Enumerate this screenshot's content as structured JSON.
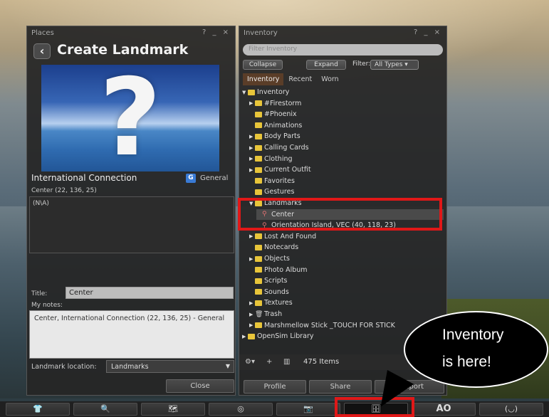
{
  "places": {
    "title": "Places",
    "controls": "? _ ×",
    "back_icon": "‹",
    "heading": "Create Landmark",
    "parcel_name": "International Connection",
    "rating_badge": "G",
    "rating_label": "General",
    "location": "Center (22, 136, 25)",
    "description": "(N\\A)",
    "title_label": "Title:",
    "title_value": "Center",
    "notes_label": "My notes:",
    "notes_value": "Center, International Connection (22, 136, 25) - General",
    "landmark_location_label": "Landmark location:",
    "landmark_location_value": "Landmarks",
    "close_label": "Close"
  },
  "inventory": {
    "title": "Inventory",
    "controls": "? _ ×",
    "filter_placeholder": "Filter Inventory",
    "collapse_label": "Collapse",
    "expand_label": "Expand",
    "filter_label": "Filter:",
    "filter_value": "All Types",
    "tabs": [
      "Inventory",
      "Recent",
      "Worn"
    ],
    "tree": [
      {
        "label": "Inventory",
        "depth": 0,
        "expanded": true,
        "kind": "folder"
      },
      {
        "label": "#Firestorm",
        "depth": 1,
        "expanded": false,
        "kind": "folder"
      },
      {
        "label": "#Phoenix",
        "depth": 1,
        "kind": "folder"
      },
      {
        "label": "Animations",
        "depth": 1,
        "kind": "folder"
      },
      {
        "label": "Body Parts",
        "depth": 1,
        "expanded": false,
        "kind": "folder"
      },
      {
        "label": "Calling Cards",
        "depth": 1,
        "expanded": false,
        "kind": "folder"
      },
      {
        "label": "Clothing",
        "depth": 1,
        "expanded": false,
        "kind": "folder"
      },
      {
        "label": "Current Outfit",
        "depth": 1,
        "expanded": false,
        "kind": "folder"
      },
      {
        "label": "Favorites",
        "depth": 1,
        "kind": "folder"
      },
      {
        "label": "Gestures",
        "depth": 1,
        "kind": "folder"
      },
      {
        "label": "Landmarks",
        "depth": 1,
        "expanded": true,
        "kind": "folder"
      },
      {
        "label": "Center",
        "depth": 2,
        "kind": "landmark"
      },
      {
        "label": "Orientation Island, VEC (40, 118, 23)",
        "depth": 2,
        "kind": "landmark"
      },
      {
        "label": "Lost And Found",
        "depth": 1,
        "expanded": false,
        "kind": "folder"
      },
      {
        "label": "Notecards",
        "depth": 1,
        "kind": "folder"
      },
      {
        "label": "Objects",
        "depth": 1,
        "expanded": false,
        "kind": "folder"
      },
      {
        "label": "Photo Album",
        "depth": 1,
        "kind": "folder"
      },
      {
        "label": "Scripts",
        "depth": 1,
        "kind": "folder"
      },
      {
        "label": "Sounds",
        "depth": 1,
        "kind": "folder"
      },
      {
        "label": "Textures",
        "depth": 1,
        "expanded": false,
        "kind": "folder"
      },
      {
        "label": "Trash",
        "depth": 1,
        "expanded": false,
        "kind": "trash"
      },
      {
        "label": "Marshmellow Stick _TOUCH FOR STICK",
        "depth": 1,
        "expanded": false,
        "kind": "folder"
      },
      {
        "label": "OpenSim Library",
        "depth": 0,
        "expanded": false,
        "kind": "folder"
      }
    ],
    "item_count": "475 Items",
    "buttons": [
      "Profile",
      "Share",
      "Teleport"
    ]
  },
  "callout": {
    "line1": "Inventory",
    "line2": "is here!"
  },
  "toolbar": {
    "buttons": [
      {
        "icon": "shirt-icon",
        "glyph": "👕"
      },
      {
        "icon": "search-icon",
        "glyph": "🔍"
      },
      {
        "icon": "map-icon",
        "glyph": "🗺"
      },
      {
        "icon": "radar-icon",
        "glyph": "◎"
      },
      {
        "icon": "camera-icon",
        "glyph": "📷"
      },
      {
        "icon": "inventory-icon",
        "glyph": "🗄"
      },
      {
        "icon": "ao-text",
        "glyph": "AO"
      },
      {
        "icon": "gesture-icon",
        "glyph": "(◡)"
      }
    ]
  },
  "colors": {
    "highlight": "#e01818",
    "folder": "#e8c53a",
    "tab_active": "#5a3d28"
  }
}
